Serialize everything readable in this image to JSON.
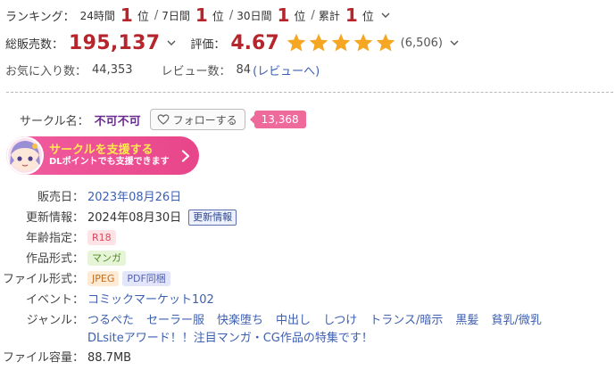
{
  "ranking": {
    "label": "ランキング：",
    "items": [
      {
        "period": "24時間",
        "rank": "1",
        "unit": "位"
      },
      {
        "period": "7日間",
        "rank": "1",
        "unit": "位"
      },
      {
        "period": "30日間",
        "rank": "1",
        "unit": "位"
      },
      {
        "period": "累計",
        "rank": "1",
        "unit": "位"
      }
    ],
    "separator": "/",
    "icon": "chevron-down-icon"
  },
  "sales": {
    "label": "総販売数：",
    "value": "195,137",
    "rating_label": "評価：",
    "rating": "4.67",
    "stars": 5,
    "star_color": "#f5a623",
    "rating_count": "(6,506)"
  },
  "favorites": {
    "label": "お気に入り数：",
    "value": "44,353",
    "review_label": "レビュー数：",
    "review_value": "84",
    "review_link": "(レビューへ)"
  },
  "circle": {
    "label": "サークル名：",
    "name": "不可不可",
    "follow_label": "フォローする",
    "follower_count": "13,368"
  },
  "support": {
    "title": "サークルを支援する",
    "subtitle": "DLポイントでも支援できます",
    "icon": "chevron-right-icon"
  },
  "details": {
    "release_label": "販売日：",
    "release_value": "2023年08月26日",
    "update_label": "更新情報：",
    "update_value": "2024年08月30日",
    "update_tag": "更新情報",
    "age_label": "年齢指定：",
    "age_tag": "R18",
    "format_label": "作品形式：",
    "format_tag": "マンガ",
    "file_label": "ファイル形式：",
    "file_tags": [
      "JPEG",
      "PDF同梱"
    ],
    "event_label": "イベント：",
    "event_value": "コミックマーケット102",
    "genre_label": "ジャンル：",
    "genres": [
      "つるぺた",
      "セーラー服",
      "快楽堕ち",
      "中出し",
      "しつけ",
      "トランス/暗示",
      "黒髪",
      "貧乳/微乳",
      "DLsiteアワード！！注目マンガ・CG作品の特集です！"
    ],
    "size_label": "ファイル容量：",
    "size_value": "88.7MB"
  },
  "colors": {
    "accent_red": "#b5252b",
    "link_blue": "#3d5fb2",
    "circle_purple": "#6a2c91",
    "support_pink": "#e8458a"
  }
}
